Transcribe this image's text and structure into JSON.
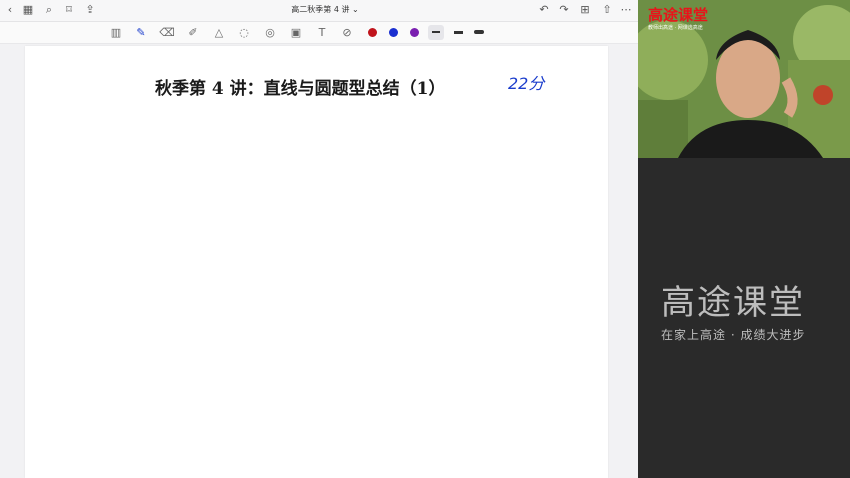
{
  "window": {
    "doc_title": "高二秋季第 4 讲 ⌄"
  },
  "icons": {
    "back": "chevron-left-icon",
    "grid": "grid-icon",
    "search": "search-icon",
    "bookmark": "bookmark-icon",
    "share": "share-icon",
    "undo": "undo-icon",
    "redo": "redo-icon",
    "add_page": "add-page-icon",
    "export": "export-icon",
    "more": "more-icon"
  },
  "toolbar": {
    "colors": [
      "#c0141c",
      "#1a2fd0",
      "#7a1fb0"
    ]
  },
  "page": {
    "title": "秋季第 4 讲：直线与圆题型总结（1）",
    "annotation": "22分"
  },
  "video": {
    "brand": "高途课堂",
    "brand_sub": "教师出高途 · 网课选高途"
  },
  "panel": {
    "brand": "高途课堂",
    "slogan": "在家上高途 · 成绩大进步"
  }
}
